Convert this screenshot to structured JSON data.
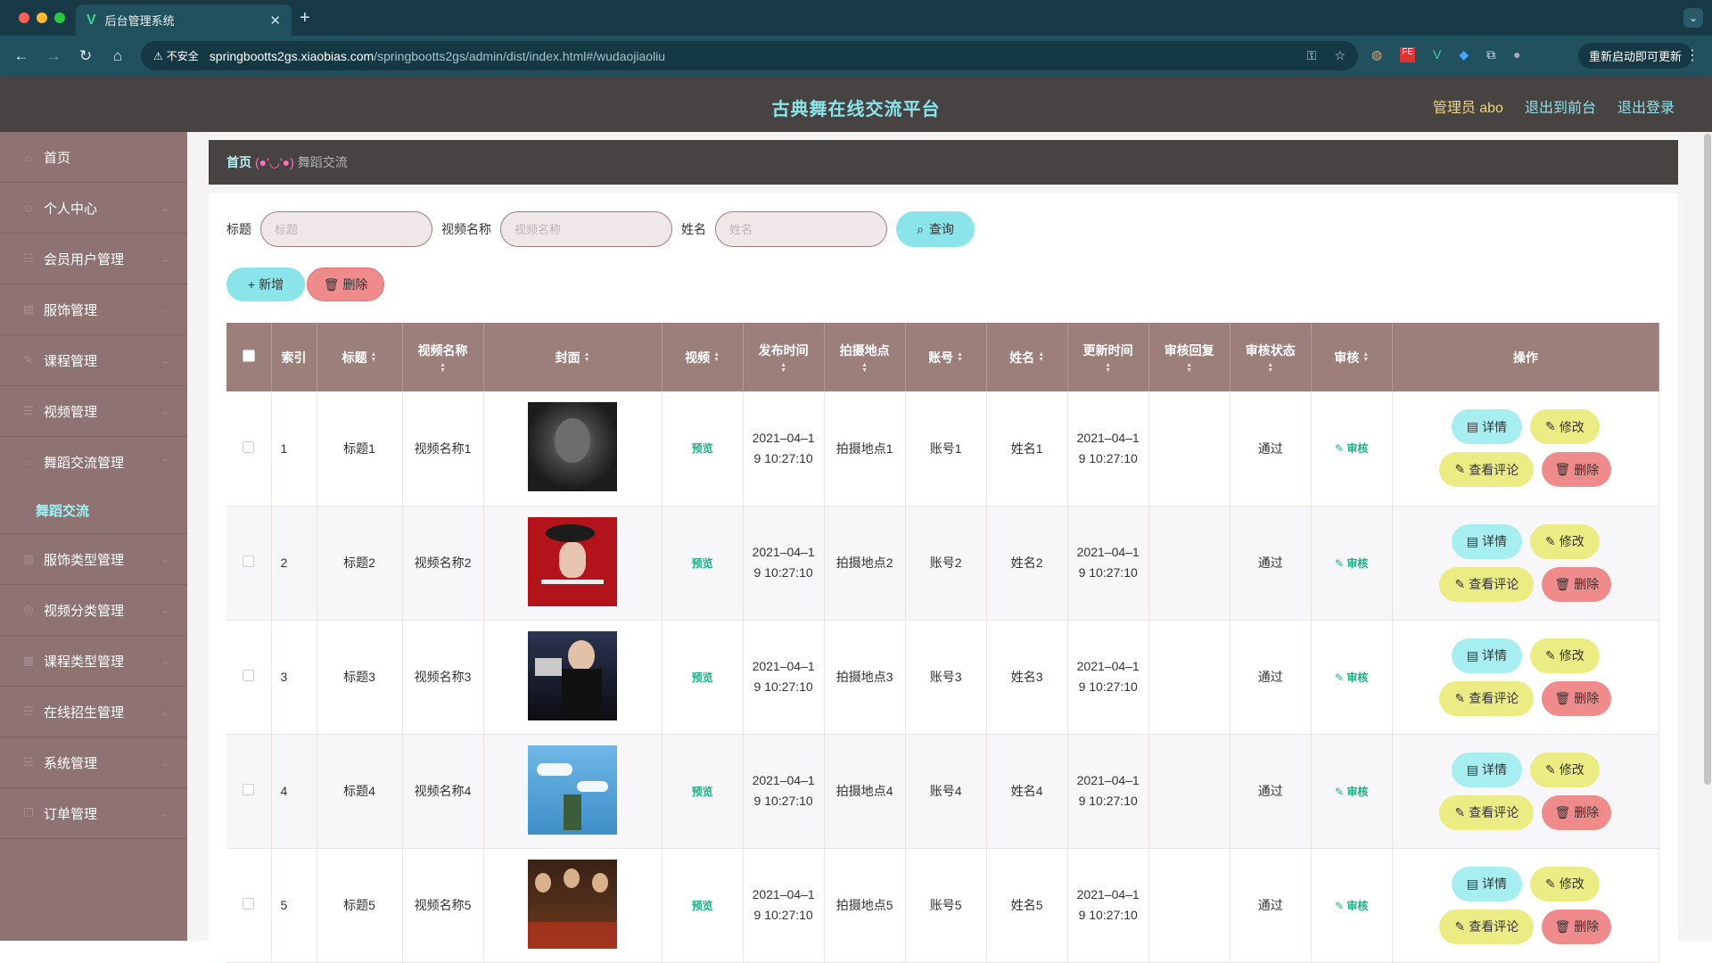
{
  "browser": {
    "tab_title": "后台管理系统",
    "tab_close": "✕",
    "new_tab": "+",
    "tab_menu": "⌄",
    "insecure_label": "不安全",
    "url_host": "springbootts2gs.xiaobias.com",
    "url_path": "/springbootts2gs/admin/dist/index.html#/wudaojiaoliu",
    "update_button": "重新启动即可更新",
    "colors": {
      "traffic_red": "#ff5f57",
      "traffic_yellow": "#febc2e",
      "traffic_green": "#28c840"
    }
  },
  "header": {
    "title": "古典舞在线交流平台",
    "admin_label": "管理员 abo",
    "front_link": "退出到前台",
    "logout_link": "退出登录"
  },
  "sidebar": {
    "items": [
      {
        "label": "首页",
        "icon": "home-icon",
        "glyph": "⌂"
      },
      {
        "label": "个人中心",
        "icon": "user-icon",
        "glyph": "☺"
      },
      {
        "label": "会员用户管理",
        "icon": "members-icon",
        "glyph": "☷"
      },
      {
        "label": "服饰管理",
        "icon": "clothing-icon",
        "glyph": "▤"
      },
      {
        "label": "课程管理",
        "icon": "course-icon",
        "glyph": "✎"
      },
      {
        "label": "视频管理",
        "icon": "video-icon",
        "glyph": "☰"
      },
      {
        "label": "舞蹈交流管理",
        "icon": "dance-icon",
        "glyph": "◌"
      },
      {
        "label": "服饰类型管理",
        "icon": "chart-icon",
        "glyph": "▥"
      },
      {
        "label": "视频分类管理",
        "icon": "category-icon",
        "glyph": "◎"
      },
      {
        "label": "课程类型管理",
        "icon": "grid-icon",
        "glyph": "▦"
      },
      {
        "label": "在线招生管理",
        "icon": "enroll-icon",
        "glyph": "☶"
      },
      {
        "label": "系统管理",
        "icon": "system-icon",
        "glyph": "☵"
      },
      {
        "label": "订单管理",
        "icon": "order-icon",
        "glyph": "❐"
      }
    ],
    "active_sub": "舞蹈交流"
  },
  "breadcrumb": {
    "home": "首页",
    "separator": "(●'◡'●)",
    "current": "舞蹈交流"
  },
  "search": {
    "title_label": "标题",
    "title_placeholder": "标题",
    "video_label": "视频名称",
    "video_placeholder": "视频名称",
    "name_label": "姓名",
    "name_placeholder": "姓名",
    "query_button": "查询"
  },
  "actions": {
    "add_button": "新增",
    "delete_button": "删除"
  },
  "table": {
    "headers": [
      "索引",
      "标题",
      "视频名称",
      "封面",
      "视频",
      "发布时间",
      "拍摄地点",
      "账号",
      "姓名",
      "更新时间",
      "审核回复",
      "审核状态",
      "审核",
      "操作"
    ],
    "rows": [
      {
        "index": "1",
        "title": "标题1",
        "video_name": "视频名称1",
        "video": "预览",
        "publish_time": "2021–04–19 10:27:10",
        "location": "拍摄地点1",
        "account": "账号1",
        "name": "姓名1",
        "update_time": "2021–04–19 10:27:10",
        "reply": "",
        "status": "通过",
        "audit": "审核",
        "cover_color": "#2b2b2b"
      },
      {
        "index": "2",
        "title": "标题2",
        "video_name": "视频名称2",
        "video": "预览",
        "publish_time": "2021–04–19 10:27:10",
        "location": "拍摄地点2",
        "account": "账号2",
        "name": "姓名2",
        "update_time": "2021–04–19 10:27:10",
        "reply": "",
        "status": "通过",
        "audit": "审核",
        "cover_color": "#b3141b"
      },
      {
        "index": "3",
        "title": "标题3",
        "video_name": "视频名称3",
        "video": "预览",
        "publish_time": "2021–04–19 10:27:10",
        "location": "拍摄地点3",
        "account": "账号3",
        "name": "姓名3",
        "update_time": "2021–04–19 10:27:10",
        "reply": "",
        "status": "通过",
        "audit": "审核",
        "cover_color": "#1e2230"
      },
      {
        "index": "4",
        "title": "标题4",
        "video_name": "视频名称4",
        "video": "预览",
        "publish_time": "2021–04–19 10:27:10",
        "location": "拍摄地点4",
        "account": "账号4",
        "name": "姓名4",
        "update_time": "2021–04–19 10:27:10",
        "reply": "",
        "status": "通过",
        "audit": "审核",
        "cover_color": "#5aa7d8"
      },
      {
        "index": "5",
        "title": "标题5",
        "video_name": "视频名称5",
        "video": "预览",
        "publish_time": "2021–04–19 10:27:10",
        "location": "拍摄地点5",
        "account": "账号5",
        "name": "姓名5",
        "update_time": "2021–04–19 10:27:10",
        "reply": "",
        "status": "通过",
        "audit": "审核",
        "cover_color": "#5a3320"
      }
    ],
    "ops": {
      "detail": "详情",
      "edit": "修改",
      "comment": "查看评论",
      "delete": "删除"
    }
  }
}
